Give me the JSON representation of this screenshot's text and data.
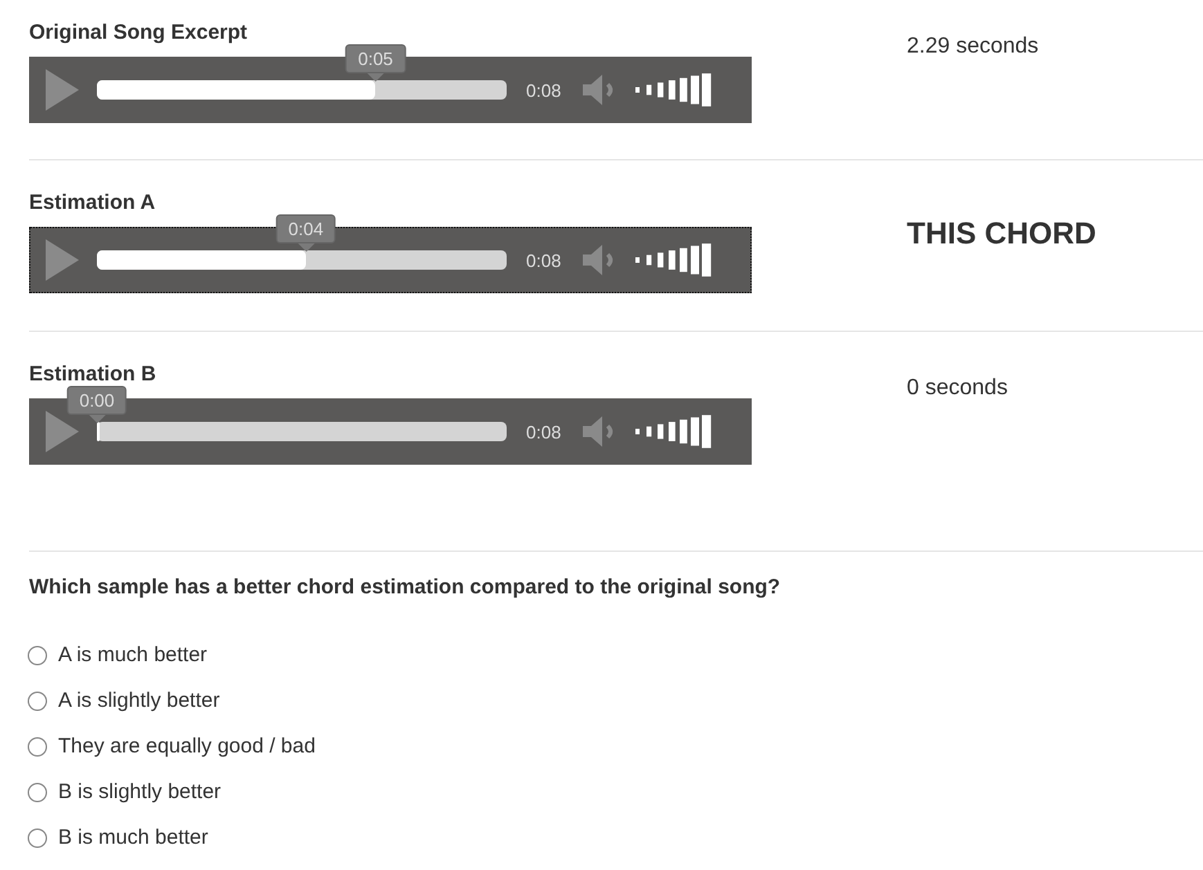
{
  "samples": [
    {
      "label": "Original Song Excerpt",
      "player": {
        "position": "0:05",
        "level": 0.68,
        "duration": "0:08",
        "focused": false
      },
      "result": "2.29 seconds",
      "emphasis": false
    },
    {
      "label": "Estimation A",
      "player": {
        "position": "0:04",
        "level": 0.51,
        "duration": "0:08",
        "focused": true
      },
      "result": "THIS CHORD",
      "emphasis": true
    },
    {
      "label": "Estimation B",
      "player": {
        "position": "0:00",
        "level": 0,
        "duration": "0:08",
        "focused": false
      },
      "result": "0 seconds",
      "emphasis": false
    }
  ],
  "question": {
    "text": "Which sample has a better chord estimation compared to the original song?",
    "options": [
      {
        "label": "A is much better",
        "selected": false
      },
      {
        "label": "A is slightly better",
        "selected": false
      },
      {
        "label": "They are equally good / bad",
        "selected": false
      },
      {
        "label": "B is slightly better",
        "selected": false
      },
      {
        "label": "B is much better",
        "selected": false
      }
    ]
  }
}
